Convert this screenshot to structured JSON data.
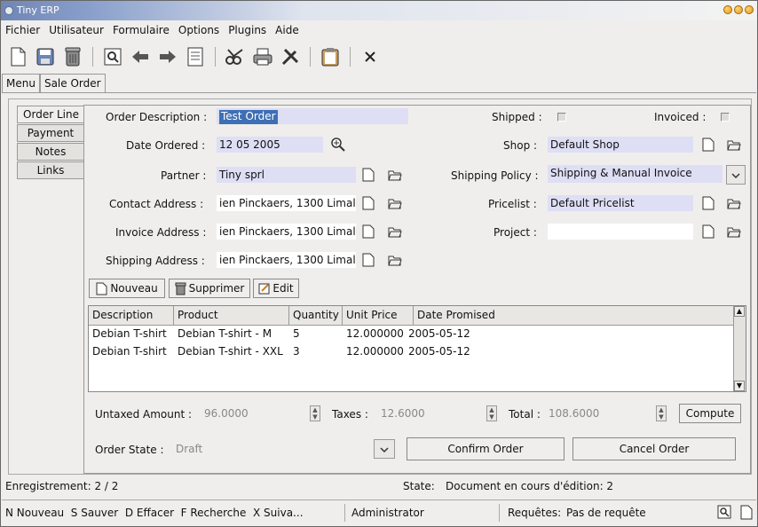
{
  "window": {
    "title": "Tiny ERP"
  },
  "menu": [
    "Fichier",
    "Utilisateur",
    "Formulaire",
    "Options",
    "Plugins",
    "Aide"
  ],
  "toolbar_icons": [
    "new-doc-icon",
    "save-icon",
    "trash-icon",
    "find-icon",
    "arrow-left-icon",
    "arrow-right-icon",
    "form-view-icon",
    "scissors-icon",
    "print-icon",
    "tools-icon",
    "clipboard-icon",
    "close-icon"
  ],
  "top_tabs": [
    "Menu",
    "Sale Order"
  ],
  "side_tabs": [
    "Order Line",
    "Payment",
    "Notes",
    "Links"
  ],
  "form": {
    "order_description_label": "Order Description :",
    "order_description": "Test Order",
    "date_ordered_label": "Date Ordered :",
    "date_ordered": "12 05 2005",
    "partner_label": "Partner :",
    "partner": "Tiny sprl",
    "contact_address_label": "Contact Address :",
    "contact_address": "ien Pinckaers, 1300 Limal",
    "invoice_address_label": "Invoice Address :",
    "invoice_address": "ien Pinckaers, 1300 Limal",
    "shipping_address_label": "Shipping Address :",
    "shipping_address": "ien Pinckaers, 1300 Limal",
    "shipped_label": "Shipped :",
    "invoiced_label": "Invoiced :",
    "shop_label": "Shop :",
    "shop": "Default Shop",
    "shipping_policy_label": "Shipping Policy :",
    "shipping_policy": "Shipping & Manual Invoice",
    "pricelist_label": "Pricelist :",
    "pricelist": "Default Pricelist",
    "project_label": "Project :",
    "project": ""
  },
  "line_buttons": {
    "new": "Nouveau",
    "delete": "Supprimer",
    "edit": "Edit"
  },
  "table": {
    "headers": [
      "Description",
      "Product",
      "Quantity",
      "Unit Price",
      "Date Promised"
    ],
    "rows": [
      [
        "Debian T-shirt",
        "Debian T-shirt - M",
        "5",
        "12.000000",
        "2005-05-12"
      ],
      [
        "Debian T-shirt",
        "Debian T-shirt - XXL",
        "3",
        "12.000000",
        "2005-05-12"
      ]
    ]
  },
  "totals": {
    "untaxed_label": "Untaxed Amount :",
    "untaxed": "96.0000",
    "taxes_label": "Taxes :",
    "taxes": "12.6000",
    "total_label": "Total :",
    "total": "108.6000",
    "compute": "Compute"
  },
  "order_state": {
    "label": "Order State :",
    "value": "Draft",
    "confirm": "Confirm Order",
    "cancel": "Cancel Order"
  },
  "status": {
    "record": "Enregistrement: 2 / 2",
    "state_label": "State:",
    "state_value": "Document en cours d'édition: 2"
  },
  "shortcuts": {
    "keys": "N Nouveau  S Sauver  D Effacer  F Recherche  X Suiva...",
    "user": "Administrator",
    "requests_label": "Requêtes:",
    "requests_value": "Pas de requête"
  },
  "colors": {
    "titlebar": "#6f86b6",
    "field_bg": "#dedef5",
    "selection": "#3e6fb5"
  }
}
